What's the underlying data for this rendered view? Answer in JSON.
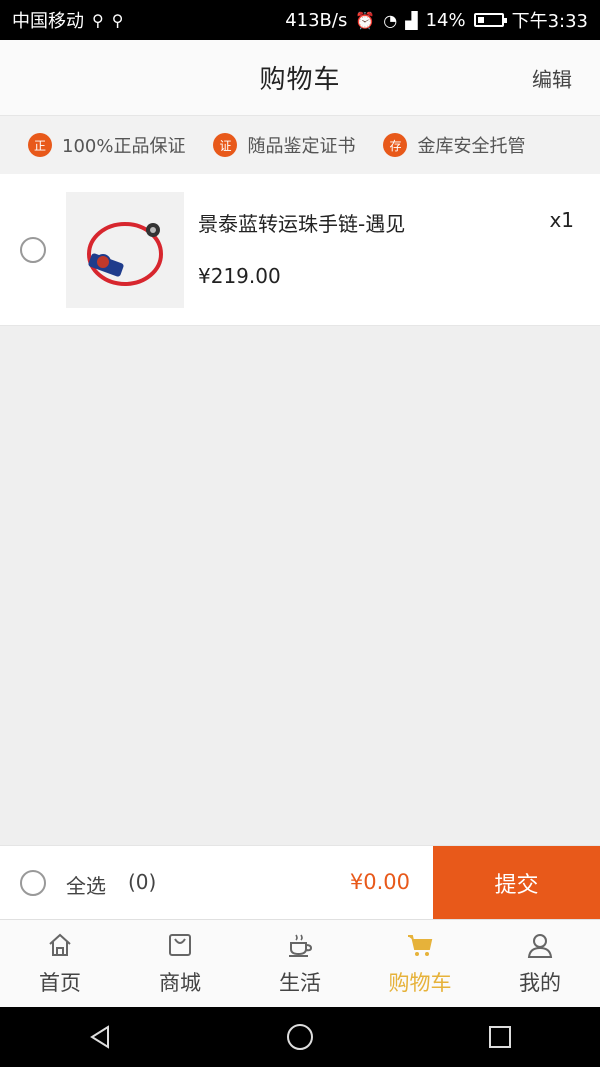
{
  "status_bar": {
    "carrier": "中国移动",
    "speed": "413B/s",
    "battery": "14%",
    "time": "下午3:33"
  },
  "header": {
    "title": "购物车",
    "edit_label": "编辑"
  },
  "guarantees": [
    {
      "badge": "正",
      "label": "100%正品保证"
    },
    {
      "badge": "证",
      "label": "随品鉴定证书"
    },
    {
      "badge": "存",
      "label": "金库安全托管"
    }
  ],
  "cart": {
    "items": [
      {
        "name": "景泰蓝转运珠手链-遇见",
        "price": "¥219.00",
        "quantity": "x1"
      }
    ]
  },
  "checkout": {
    "select_all_label": "全选",
    "selected_count": "(0)",
    "total": "¥0.00",
    "submit_label": "提交"
  },
  "tabbar": {
    "tabs": [
      {
        "label": "首页",
        "icon": "home-icon"
      },
      {
        "label": "商城",
        "icon": "shopping-bag-icon"
      },
      {
        "label": "生活",
        "icon": "coffee-cup-icon"
      },
      {
        "label": "购物车",
        "icon": "cart-icon"
      },
      {
        "label": "我的",
        "icon": "user-icon"
      }
    ],
    "active_index": 3
  },
  "colors": {
    "accent": "#e8591a",
    "tab_active": "#e6b23a"
  }
}
